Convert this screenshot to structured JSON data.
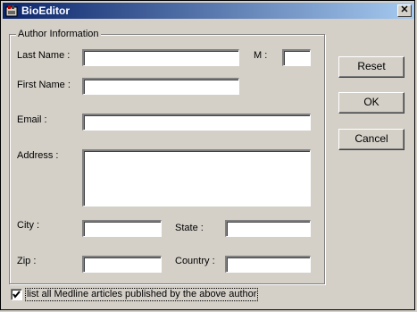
{
  "window": {
    "title": "BioEditor",
    "icon": "bioeditor-app-icon",
    "close_icon": "close-icon"
  },
  "group": {
    "legend": "Author Information"
  },
  "fields": {
    "last_name": {
      "label": "Last Name :",
      "value": ""
    },
    "middle": {
      "label": "M :",
      "value": ""
    },
    "first_name": {
      "label": "First Name :",
      "value": ""
    },
    "email": {
      "label": "Email :",
      "value": ""
    },
    "address": {
      "label": "Address :",
      "value": ""
    },
    "city": {
      "label": "City :",
      "value": ""
    },
    "state": {
      "label": "State :",
      "value": ""
    },
    "zip": {
      "label": "Zip :",
      "value": ""
    },
    "country": {
      "label": "Country :",
      "value": ""
    }
  },
  "buttons": {
    "reset": "Reset",
    "ok": "OK",
    "cancel": "Cancel"
  },
  "checkbox": {
    "label": "list all Medline articles published by the above author",
    "checked": true
  }
}
